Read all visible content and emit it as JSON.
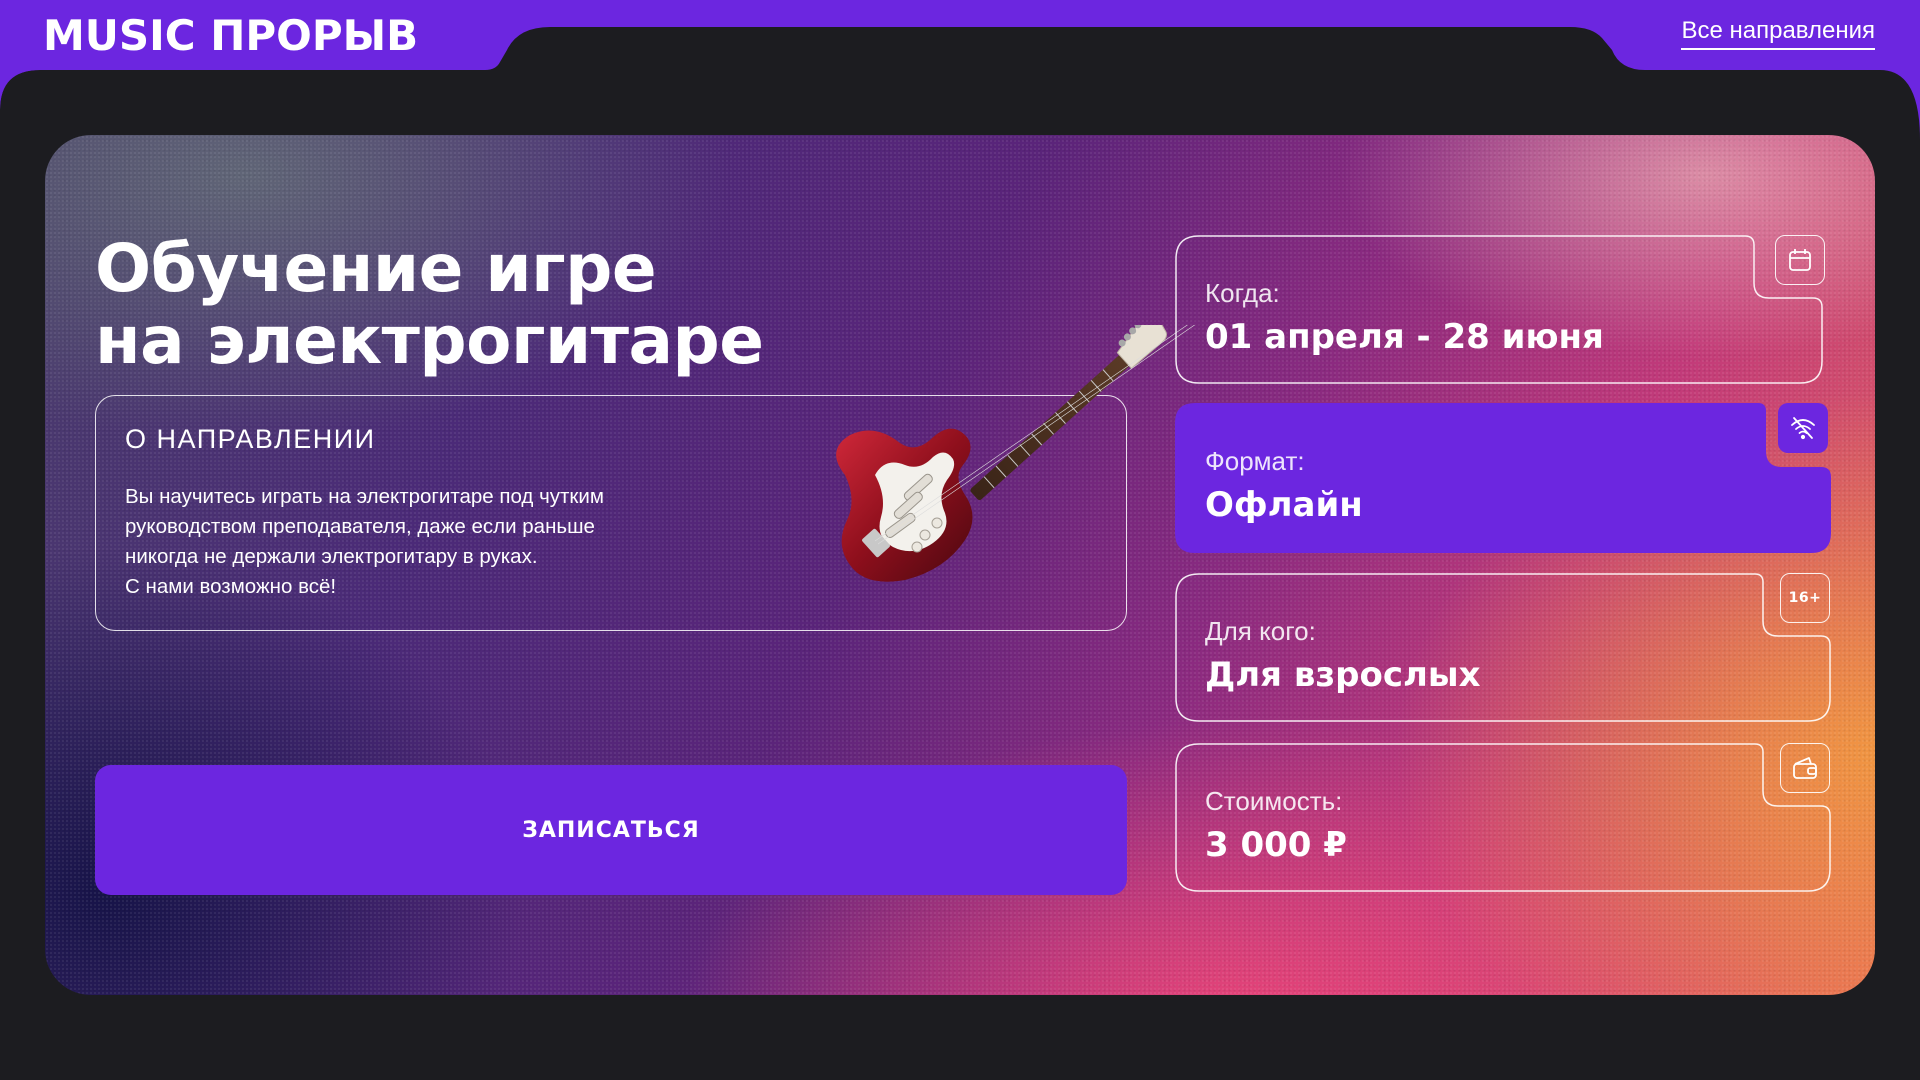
{
  "header": {
    "brand": "MUSIC ПРОРЫВ",
    "all_directions_link": "Все направления"
  },
  "course": {
    "title_line1": "Обучение игре",
    "title_line2": "на электрогитаре",
    "about_heading": "О НАПРАВЛЕНИИ",
    "about_lines": [
      "Вы научитесь играть на электрогитаре под чутким",
      "руководством преподавателя, даже если раньше",
      "никогда не держали электрогитару в руках.",
      "С нами возможно всё!"
    ],
    "signup_label": "ЗАПИСАТЬСЯ",
    "image": "electric-guitar"
  },
  "info_cards": [
    {
      "label": "Когда:",
      "value": "01 апреля - 28 июня",
      "icon": "calendar-icon"
    },
    {
      "label": "Формат:",
      "value": "Офлайн",
      "icon": "no-wifi-icon"
    },
    {
      "label": "Для кого:",
      "value": "Для взрослых",
      "icon": "age-rating-icon",
      "badge_text": "16+"
    },
    {
      "label": "Стоимость:",
      "value": "3 000 ₽",
      "icon": "wallet-icon"
    }
  ],
  "colors": {
    "accent": "#6c26e0",
    "page_background": "#1c1c20",
    "text": "#ffffff"
  }
}
